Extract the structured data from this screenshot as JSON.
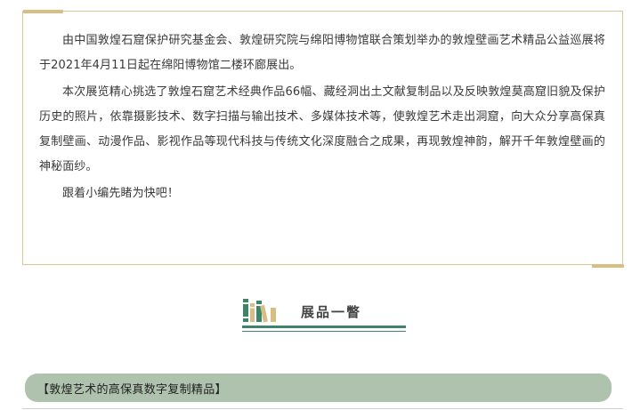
{
  "intro": {
    "paragraphs": [
      "由中国敦煌石窟保护研究基金会、敦煌研究院与绵阳博物馆联合策划举办的敦煌壁画艺术精品公益巡展将于2021年4月11日起在绵阳博物馆二楼环廊展出。",
      "本次展览精心挑选了敦煌石窟艺术经典作品66幅、藏经洞出土文献复制品以及反映敦煌莫高窟旧貌及保护历史的照片，依靠摄影技术、数字扫描与输出技术、多媒体技术等，使敦煌艺术走出洞窟，向大众分享高保真复制壁画、动漫作品、影视作品等现代科技与传统文化深度融合之成果，再现敦煌神韵，解开千年敦煌壁画的神秘面纱。",
      "跟着小编先睹为快吧！"
    ]
  },
  "section": {
    "title": "展品一瞥",
    "icon": "books-icon",
    "colors": {
      "green": "#3f8468",
      "tan": "#d8be84"
    }
  },
  "category": {
    "label": "【敦煌艺术的高保真数字复制精品】"
  },
  "colors": {
    "frame_border": "#d9c793",
    "accent": "#d8be84",
    "banner": "#afc2ae",
    "underline": "#3f8468"
  }
}
